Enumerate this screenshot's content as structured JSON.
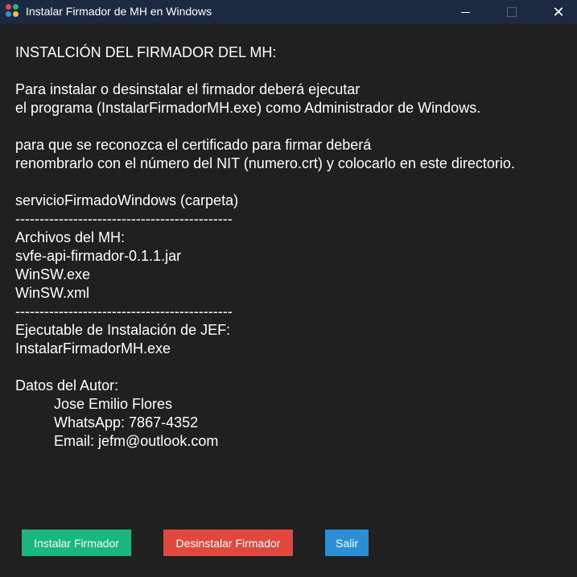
{
  "window": {
    "title": "Instalar Firmador de MH en Windows",
    "icon": "app-icon",
    "close_glyph": "✕"
  },
  "content": {
    "heading": "INSTALCIÓN DEL FIRMADOR DEL MH:",
    "para1_line1": "Para instalar o desinstalar el firmador deberá ejecutar",
    "para1_line2": "el programa (InstalarFirmadorMH.exe) como Administrador de Windows.",
    "para2_line1": "para que se reconozca el certificado para firmar deberá",
    "para2_line2": "renombrarlo con el número del NIT (numero.crt) y colocarlo en este directorio.",
    "folder_label": "servicioFirmadoWindows (carpeta)",
    "separator": "---------------------------------------------",
    "files_heading": "Archivos del MH:",
    "files": [
      "svfe-api-firmador-0.1.1.jar",
      "WinSW.exe",
      "WinSW.xml"
    ],
    "installer_heading": "Ejecutable de Instalación de JEF:",
    "installer_file": "InstalarFirmadorMH.exe",
    "author_heading": "Datos del Autor:",
    "author_name": "Jose Emilio Flores",
    "author_whatsapp": "WhatsApp: 7867-4352",
    "author_email": "Email: jefm@outlook.com"
  },
  "buttons": {
    "install": "Instalar Firmador",
    "uninstall": "Desinstalar Firmador",
    "exit": "Salir"
  },
  "colors": {
    "background": "#202020",
    "titlebar": "#1b2a40",
    "install": "#1ab87f",
    "uninstall": "#e0473f",
    "exit": "#2a8fd6"
  }
}
